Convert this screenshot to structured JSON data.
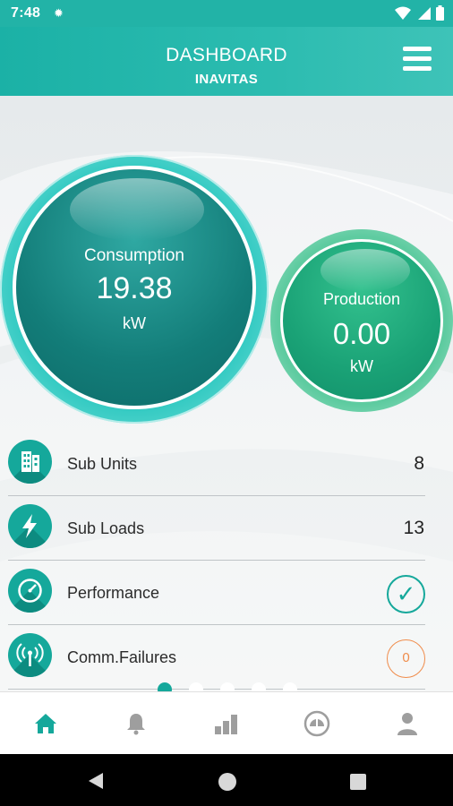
{
  "status_bar": {
    "time": "7:48",
    "icons": [
      "gear-icon",
      "wifi-icon",
      "signal-icon",
      "battery-icon"
    ]
  },
  "header": {
    "title": "DASHBOARD",
    "subtitle": "INAVITAS",
    "menu_icon": "hamburger-menu-icon"
  },
  "consumption": {
    "label": "Consumption",
    "value": "19.38",
    "unit": "kW"
  },
  "production": {
    "label": "Production",
    "value": "0.00",
    "unit": "kW"
  },
  "list": [
    {
      "icon": "building-icon",
      "label": "Sub Units",
      "value": "8"
    },
    {
      "icon": "lightning-bolt-icon",
      "label": "Sub Loads",
      "value": "13"
    },
    {
      "icon": "gauge-icon",
      "label": "Performance",
      "status": "✓"
    },
    {
      "icon": "antenna-signal-icon",
      "label": "Comm.Failures",
      "badge": "0"
    }
  ],
  "pager": {
    "count": 5,
    "active_index": 0
  },
  "bottom_nav": [
    {
      "icon": "home-icon",
      "active": true
    },
    {
      "icon": "bell-icon",
      "active": false
    },
    {
      "icon": "bar-chart-icon",
      "active": false
    },
    {
      "icon": "meter-icon",
      "active": false
    },
    {
      "icon": "user-icon",
      "active": false
    }
  ],
  "colors": {
    "accent": "#15a89b",
    "header": "#22b3a7",
    "production": "#1aa276",
    "alarm": "#f08c4b",
    "inactive_icon": "#9e9e9e"
  }
}
